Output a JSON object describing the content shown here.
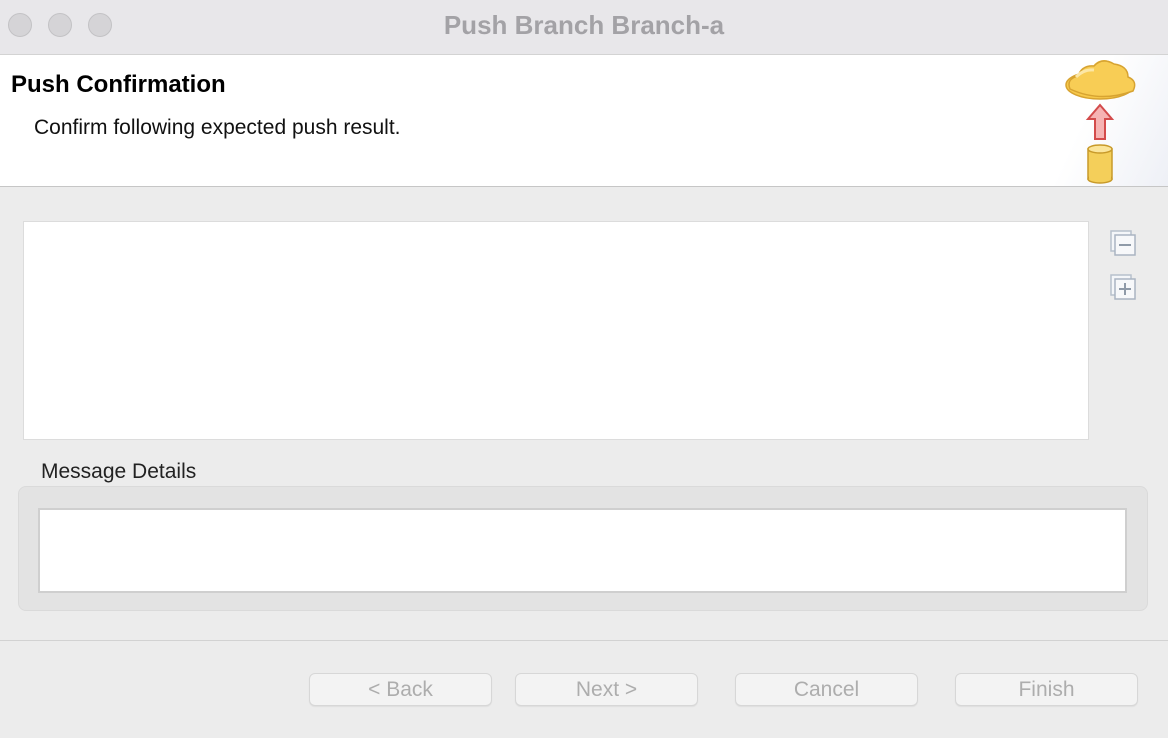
{
  "window": {
    "title": "Push Branch Branch-a"
  },
  "banner": {
    "title": "Push Confirmation",
    "message": "Confirm following expected push result.",
    "image_icon": "cloud-upload-icon"
  },
  "results": {
    "rows": [],
    "collapse_icon": "collapse-all-icon",
    "expand_icon": "expand-all-icon"
  },
  "details": {
    "label": "Message Details",
    "text": ""
  },
  "buttons": {
    "back": "< Back",
    "next": "Next >",
    "cancel": "Cancel",
    "finish": "Finish"
  },
  "colors": {
    "cloud": "#f6cb4d",
    "arrow": "#e05a5a",
    "cylinder": "#f4d05a",
    "disabled_text": "#adadad"
  }
}
